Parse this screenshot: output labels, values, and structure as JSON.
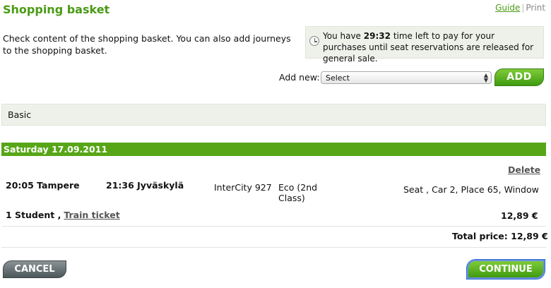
{
  "header": {
    "title": "Shopping basket",
    "guide_label": "Guide",
    "separator": "|",
    "print_label": "Print"
  },
  "intro": {
    "text": "Check content of the shopping basket. You can also add journeys to the shopping basket."
  },
  "timer": {
    "icon": "clock-icon",
    "prefix": "You have",
    "time_left": "29:32",
    "suffix": "time left to pay for your purchases until seat reservations are released for general sale."
  },
  "add_new": {
    "label": "Add new:",
    "selected": "Select",
    "button_label": "ADD"
  },
  "section": {
    "label": "Basic"
  },
  "journey": {
    "date_header": "Saturday 17.09.2011",
    "delete_label": "Delete",
    "departure": "20:05 Tampere",
    "arrival": "21:36 Jyväskylä",
    "train": "InterCity 927",
    "class": "Eco (2nd Class)",
    "seat": "Seat , Car 2, Place 65, Window",
    "passenger": "1 Student ,",
    "ticket_type": "Train ticket",
    "price": "12,89 €"
  },
  "total": {
    "label": "Total price: 12,89 €"
  },
  "footer": {
    "cancel_label": "CANCEL",
    "continue_label": "CONTINUE"
  },
  "colors": {
    "brand_green": "#4a9b14",
    "bar_green": "#57a617",
    "panel_bg": "#eef1ea"
  }
}
